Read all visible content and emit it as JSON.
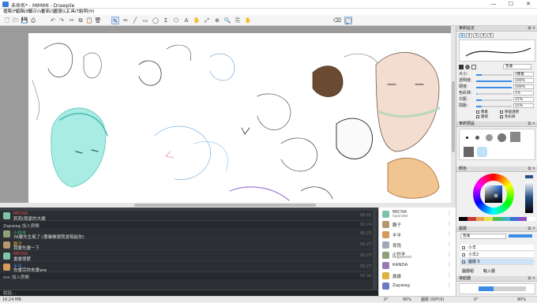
{
  "window": {
    "title": "未命名* - MIMIMI - Drawpile",
    "controls": [
      "—",
      "☐",
      "✕"
    ]
  },
  "menu": [
    "檔案(F)",
    "編輯(E)",
    "顯示(V)",
    "畫面(S)",
    "圖層(L)",
    "工具(T)",
    "說明(H)"
  ],
  "toolbar": {
    "icons": [
      "🗋",
      "🗁",
      "💾",
      "⎙",
      "↶",
      "↷",
      "✂",
      "⧉",
      "📋",
      "🗑",
      "✎",
      "✏",
      "╱",
      "▭",
      "◯",
      "Σ",
      "⬡",
      "A",
      "✋",
      "⤢",
      "⊕",
      "🔍",
      "⎘",
      "✋",
      "⌫",
      "💬"
    ]
  },
  "chat": {
    "messages": [
      {
        "type": "user",
        "name": "MICHA",
        "text": "莉莉(我家的大姨",
        "time": "00:21",
        "color": "#e24b4b",
        "avatar": "#7cc4a8"
      },
      {
        "type": "system",
        "text": "Zapwag 加入房間",
        "time": "00:24"
      },
      {
        "type": "user",
        "name": "小羚羊",
        "text": "YA要先生氣了·(專業帳號我會稿給你)",
        "time": "00:25",
        "color": "#3fbf6a",
        "avatar": "#8fa07a"
      },
      {
        "type": "user",
        "name": "鵬子",
        "text": "我要先畫一下",
        "time": "00:27",
        "color": "#d7a437",
        "avatar": "#b4986c"
      },
      {
        "type": "user",
        "name": "MICHA",
        "text": "畫畫很愛",
        "time": "00:27",
        "color": "#e24b4b",
        "avatar": "#7cc4a8"
      },
      {
        "type": "user",
        "name": "半半",
        "text": "你畫完你來畫ww",
        "time": "00:27",
        "color": "#3b8ce6",
        "avatar": "#d49b5a"
      },
      {
        "type": "system",
        "text": "ccc 加入房間",
        "time": "00:30"
      }
    ],
    "input_placeholder": "說話..."
  },
  "users": [
    {
      "name": "MICHA",
      "role": "Operator",
      "avatar": "#7cc4a8"
    },
    {
      "name": "鵬子",
      "role": "",
      "avatar": "#b4986c"
    },
    {
      "name": "半半",
      "role": "",
      "avatar": "#d49b5a"
    },
    {
      "name": "夜雨",
      "role": "",
      "avatar": "#a2a8b8"
    },
    {
      "name": "小羚羊",
      "role": "Registered",
      "avatar": "#8fa07a"
    },
    {
      "name": "KANDA",
      "role": "",
      "avatar": "#9a7ab5"
    },
    {
      "name": "露露",
      "role": "",
      "avatar": "#e0b040"
    },
    {
      "name": "Zapwag",
      "role": "",
      "avatar": "#6c7ac9"
    }
  ],
  "statusbar": {
    "size": "16:24 MB",
    "zoom_left": "0°",
    "zoom_pct": "90%",
    "mode_label": "圖層 ODF(0)",
    "zoom_right": "0°",
    "zoom_right_pct": "90%"
  },
  "brush": {
    "title": "筆刷設定",
    "tabs": [
      "1",
      "2",
      "3",
      "4",
      "5"
    ],
    "mode": "普通",
    "sliders": [
      {
        "label": "大小:",
        "value": "3像素",
        "fill": 0.15
      },
      {
        "label": "透明度:",
        "value": "100%",
        "fill": 1.0
      },
      {
        "label": "硬度:",
        "value": "100%",
        "fill": 1.0
      },
      {
        "label": "色彩抹:",
        "value": "1%",
        "fill": 0.03
      },
      {
        "label": "次距:",
        "value": "15%",
        "fill": 0.15
      },
      {
        "label": "間距:",
        "value": "15%",
        "fill": 0.15
      }
    ],
    "checks": [
      "像素",
      "保留透明",
      "壓感",
      "色彩抹"
    ]
  },
  "palette": {
    "title": "筆刷預設",
    "swatches": [
      "#111111",
      "#555555",
      "#999999",
      "#d0d0d0",
      "#ffffff",
      "#bfe1f6"
    ]
  },
  "color": {
    "title": "顏色",
    "current": "#2a4f86"
  },
  "layers": {
    "title": "圖層",
    "blend": "普通",
    "items": [
      "小羊",
      "小羊2",
      "圖層 5"
    ],
    "buttons": [
      "圖層組",
      "輸入層"
    ]
  },
  "navigator": {
    "title": "導航器",
    "zoom": "90%"
  }
}
